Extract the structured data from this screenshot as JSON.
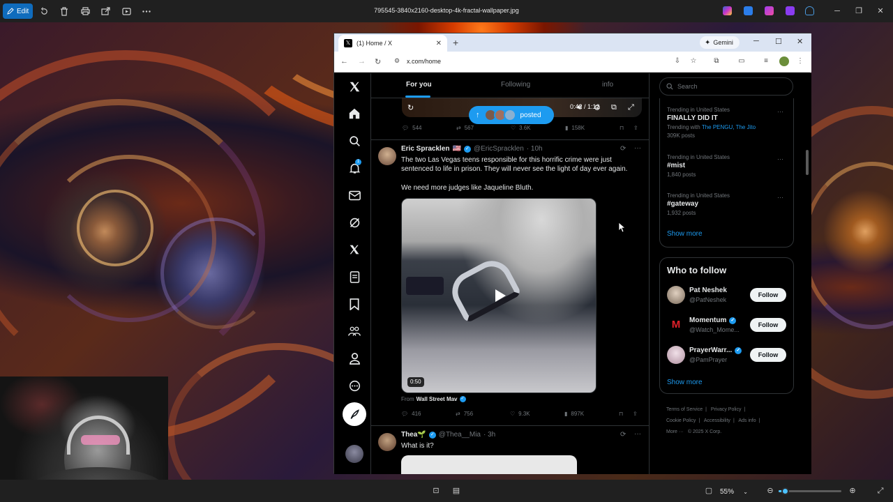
{
  "viewer": {
    "edit_label": "Edit",
    "file_title": "795545-3840x2160-desktop-4k-fractal-wallpaper.jpg",
    "zoom": "55%",
    "zoom_fraction": 0.1
  },
  "browser": {
    "tab_title": "(1) Home / X",
    "gemini_label": "Gemini",
    "url": "x.com/home"
  },
  "x": {
    "notif_badge": "1",
    "tabs": [
      "For you",
      "Following",
      "info"
    ],
    "prev_post": {
      "video_time": "0:42 / 1:12",
      "posted_pill": "posted",
      "replies": "544",
      "reposts": "567",
      "likes": "3.6K",
      "views": "158K"
    },
    "post1": {
      "name": "Eric Spracklen",
      "flag": "🇺🇸",
      "handle": "@EricSpracklen",
      "time": "· 10h",
      "text1": "The two Las Vegas teens responsible for this horrific crime were just sentenced to life in prison. They will never see the light of day ever again.",
      "text2": "We need more judges like Jaqueline Bluth.",
      "video_duration": "0:50",
      "from_prefix": "From",
      "from_source": "Wall Street Mav",
      "replies": "416",
      "reposts": "756",
      "likes": "9.3K",
      "views": "897K"
    },
    "post2": {
      "name": "Thea🌱",
      "handle": "@Thea__Mia",
      "time": "· 3h",
      "text": "What is it?"
    },
    "search_placeholder": "Search",
    "trends": [
      {
        "context": "Trending in United States",
        "name": "FINALLY DID IT",
        "with_prefix": "Trending with",
        "with_links": "The PENGU, The Jito",
        "count": "309K posts"
      },
      {
        "context": "Trending in United States",
        "name": "#mist",
        "count": "1,840 posts"
      },
      {
        "context": "Trending in United States",
        "name": "#gateway",
        "count": "1,932 posts"
      }
    ],
    "trends_show_more": "Show more",
    "who_to_follow": {
      "title": "Who to follow",
      "items": [
        {
          "name": "Pat Neshek",
          "handle": "@PatNeshek",
          "button": "Follow"
        },
        {
          "name": "Momentum",
          "handle": "@Watch_Mome...",
          "button": "Follow"
        },
        {
          "name": "PrayerWarr...",
          "handle": "@PamPrayer",
          "button": "Follow"
        }
      ],
      "show_more": "Show more"
    },
    "footer": [
      "Terms of Service",
      "|",
      "Privacy Policy",
      "|",
      "Cookie Policy",
      "|",
      "Accessibility",
      "|",
      "Ads info",
      "|",
      "More ···",
      "© 2025 X Corp."
    ]
  },
  "colors": {
    "accent": "#1d9bf0",
    "edit_button": "#0f6cbd",
    "zoom_accent": "#4cc2ff"
  }
}
